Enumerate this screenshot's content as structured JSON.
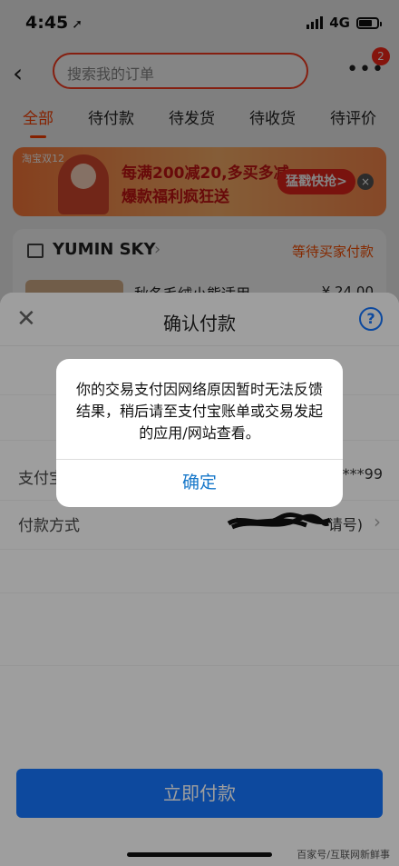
{
  "status": {
    "time": "4:45",
    "network": "4G"
  },
  "header": {
    "search_placeholder": "搜索我的订单",
    "badge": "2"
  },
  "tabs": [
    {
      "label": "全部"
    },
    {
      "label": "待付款"
    },
    {
      "label": "待发货"
    },
    {
      "label": "待收货"
    },
    {
      "label": "待评价"
    }
  ],
  "banner": {
    "tag": "淘宝双12",
    "line1": "每满200减20,多买多减",
    "line2": "爆款福利疯狂送",
    "button": "猛戳快抢>"
  },
  "order": {
    "shop_name": "YUMIN SKY",
    "status": "等待买家付款",
    "item_title": "秋冬毛绒小熊适用",
    "item_price": "¥ 24.00"
  },
  "sheet": {
    "title": "确认付款",
    "account_label": "支付宝",
    "account_value": "***99",
    "method_label": "付款方式",
    "method_value": "请号)",
    "pay_button": "立即付款"
  },
  "alert": {
    "message": "你的交易支付因网络原因暂时无法反馈结果，稍后请至支付宝账单或交易发起的应用/网站查看。",
    "confirm": "确定"
  },
  "watermark": "百家号/互联网新鲜事"
}
